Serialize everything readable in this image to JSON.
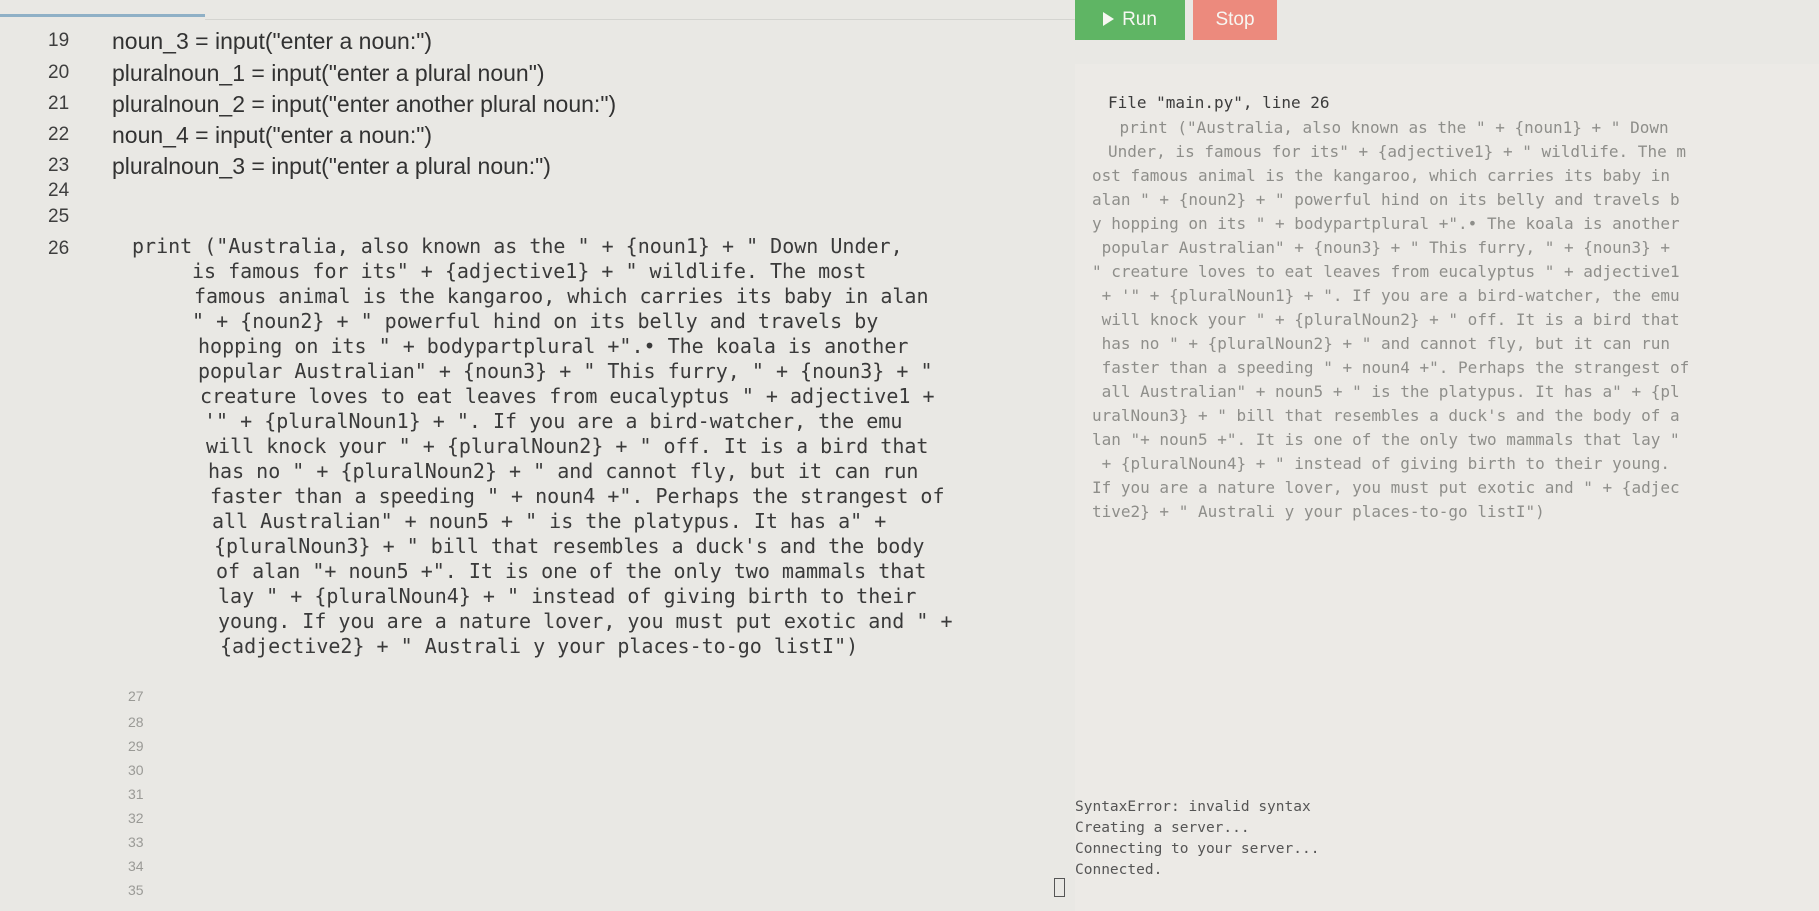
{
  "toolbar": {
    "run_label": "Run",
    "stop_label": "Stop",
    "colors": {
      "run": "#5fb564",
      "stop": "#ec8a7d"
    },
    "icons": {
      "run": "play-icon"
    }
  },
  "editor": {
    "lines": [
      {
        "num": "19",
        "text": "noun_3 = input(\"enter a noun:\")"
      },
      {
        "num": "20",
        "text": "pluralnoun_1 = input(\"enter a plural noun\")"
      },
      {
        "num": "21",
        "text": "pluralnoun_2 = input(\"enter another plural noun:\")"
      },
      {
        "num": "22",
        "text": "noun_4 = input(\"enter a noun:\")"
      },
      {
        "num": "23",
        "text": "pluralnoun_3 = input(\"enter a plural noun:\")"
      },
      {
        "num": "24",
        "text": ""
      },
      {
        "num": "25",
        "text": ""
      }
    ],
    "line26": {
      "num": "26",
      "wrapped": [
        "print (\"Australia, also known as the \" + {noun1} + \" Down Under,",
        "is famous for its\" + {adjective1} + \" wildlife. The most",
        "famous animal is the kangaroo, which carries its baby in alan",
        "\" + {noun2} + \" powerful hind on its belly and travels by",
        "hopping on its \" + bodypartplural +\".• The koala is another",
        "popular Australian\" + {noun3} + \" This furry, \" + {noun3} + \"",
        "creature loves to eat leaves from eucalyptus \" + adjective1 +",
        "'\" + {pluralNoun1} + \". If you are a bird-watcher, the emu",
        "will knock your \" + {pluralNoun2} + \" off. It is a bird that",
        "has no \" + {pluralNoun2} + \" and cannot fly, but it can run",
        "faster than a speeding \" + noun4 +\". Perhaps the strangest of",
        "all Australian\" + noun5 + \" is the platypus. It has a\" +",
        "{pluralNoun3} + \" bill that resembles a duck's and the body",
        "of alan \"+ noun5 +\". It is one of the only two mammals that",
        "lay \" + {pluralNoun4} + \" instead of giving birth to their",
        "young. If you are a nature lover, you must put exotic and \" +",
        "{adjective2} + \" Australi y your places-to-go listI\")"
      ]
    },
    "trailing_numbers": [
      "27",
      "28",
      "29",
      "30",
      "31",
      "32",
      "33",
      "34",
      "35"
    ]
  },
  "console": {
    "traceback": [
      "File \"main.py\", line 26",
      "    print (\"Australia, also known as the \" + {noun1} + \" Down",
      "Under, is famous for its\" + {adjective1} + \" wildlife. The m",
      "ost famous animal is the kangaroo, which carries its baby in",
      "alan \" + {noun2} + \" powerful hind on its belly and travels b",
      "y hopping on its \" + bodypartplural +\".• The koala is another",
      " popular Australian\" + {noun3} + \" This furry, \" + {noun3} +",
      "\" creature loves to eat leaves from eucalyptus \" + adjective1",
      " + '\" + {pluralNoun1} + \". If you are a bird-watcher, the emu",
      " will knock your \" + {pluralNoun2} + \" off. It is a bird that",
      " has no \" + {pluralNoun2} + \" and cannot fly, but it can run",
      " faster than a speeding \" + noun4 +\". Perhaps the strangest of",
      " all Australian\" + noun5 + \" is the platypus. It has a\" + {pl",
      "uralNoun3} + \" bill that resembles a duck's and the body of a",
      "lan \"+ noun5 +\". It is one of the only two mammals that lay \"",
      " + {pluralNoun4} + \" instead of giving birth to their young.",
      "If you are a nature lover, you must put exotic and \" + {adjec",
      "tive2} + \" Australi y your places-to-go listI\")"
    ],
    "status": [
      "SyntaxError: invalid syntax",
      "Creating a server...",
      "Connecting to your server...",
      "Connected."
    ]
  }
}
